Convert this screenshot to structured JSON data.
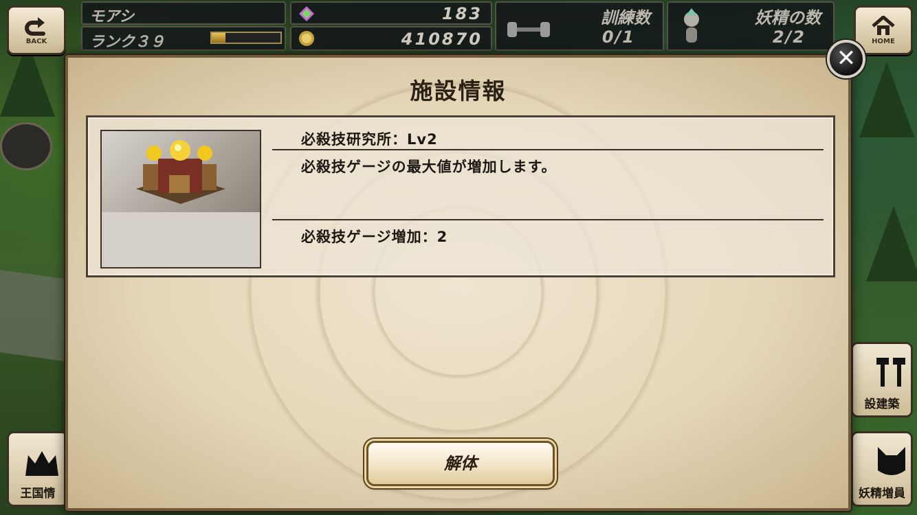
{
  "hud": {
    "back_label": "BACK",
    "home_label": "HOME",
    "player_name": "モアシ",
    "rank_label": "ランク３９",
    "rank_progress": 0.2,
    "gems": "183",
    "gold": "410870",
    "training_title": "訓練数",
    "training_value": "0/1",
    "fairy_title": "妖精の数",
    "fairy_value": "2/2"
  },
  "side": {
    "crown_label": "王国情",
    "build_label": "設建築",
    "fairy_label": "妖精増員"
  },
  "panel": {
    "title": "施設情報",
    "facility_name": "必殺技研究所：Lv2",
    "description": "必殺技ゲージの最大値が増加します。",
    "effect": "必殺技ゲージ増加：2",
    "action_label": "解体",
    "close_symbol": "✕"
  },
  "colors": {
    "panel_bg": "#e9dcc2",
    "panel_border": "#6f5b3c",
    "button_border": "#6e5326",
    "rank_bar": "#e8c25a"
  }
}
